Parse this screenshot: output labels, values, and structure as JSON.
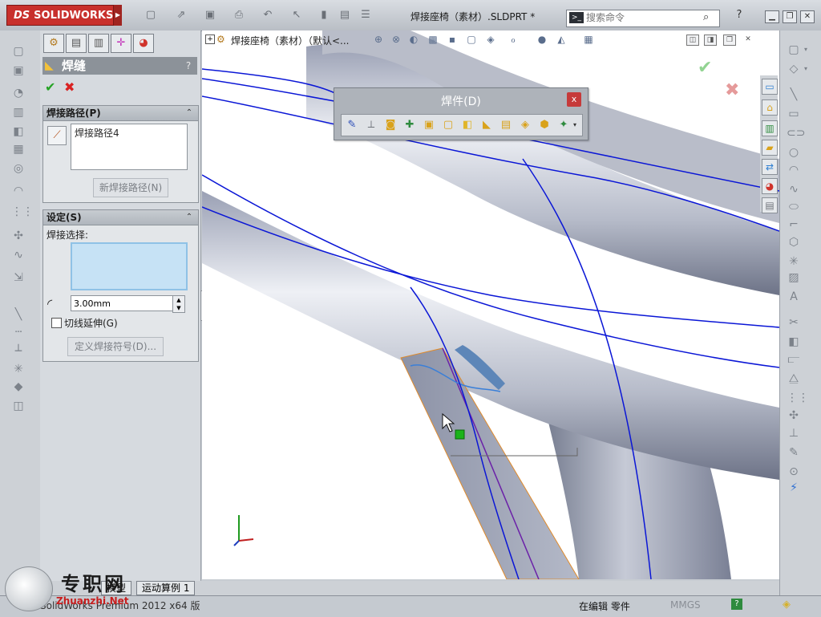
{
  "app": {
    "brand": "SOLIDWORKS",
    "brand_mark": "DS",
    "document_title": "焊接座椅（素材）.SLDPRT *",
    "search": {
      "placeholder": "搜索命令"
    }
  },
  "property_manager": {
    "title": "焊缝",
    "help": "?",
    "ok": "✔",
    "cancel": "✖",
    "weld_path_group": {
      "title": "焊接路径(P)",
      "items": [
        "焊接路径4"
      ],
      "new_button": "新焊接路径(N)"
    },
    "settings_group": {
      "title": "设定(S)",
      "weld_selection_label": "焊接选择:",
      "bead_size": "3.00mm",
      "tangent_label": "切线延伸(G)",
      "define_symbol_button": "定义焊接符号(D)..."
    }
  },
  "viewport": {
    "tree_label": "焊接座椅（素材）（默认<..."
  },
  "weldments_toolbar": {
    "title": "焊件(D)",
    "close": "x"
  },
  "bottom_tabs": {
    "tabs": [
      "模型",
      "运动算例 1"
    ]
  },
  "statusbar": {
    "version": "SolidWorks Premium 2012 x64 版",
    "editing": "在编辑 零件",
    "units": "MMGS",
    "help": "?"
  },
  "watermark": {
    "text": "专职网",
    "subtext": "Zhuanzhi.Net"
  },
  "colors": {
    "brand_red": "#c8302c",
    "panel_header": "#8c9299",
    "selection_box": "#c6e2f5",
    "tube_gray": "#8f96a8",
    "sketch_blue": "#0a16d6"
  }
}
